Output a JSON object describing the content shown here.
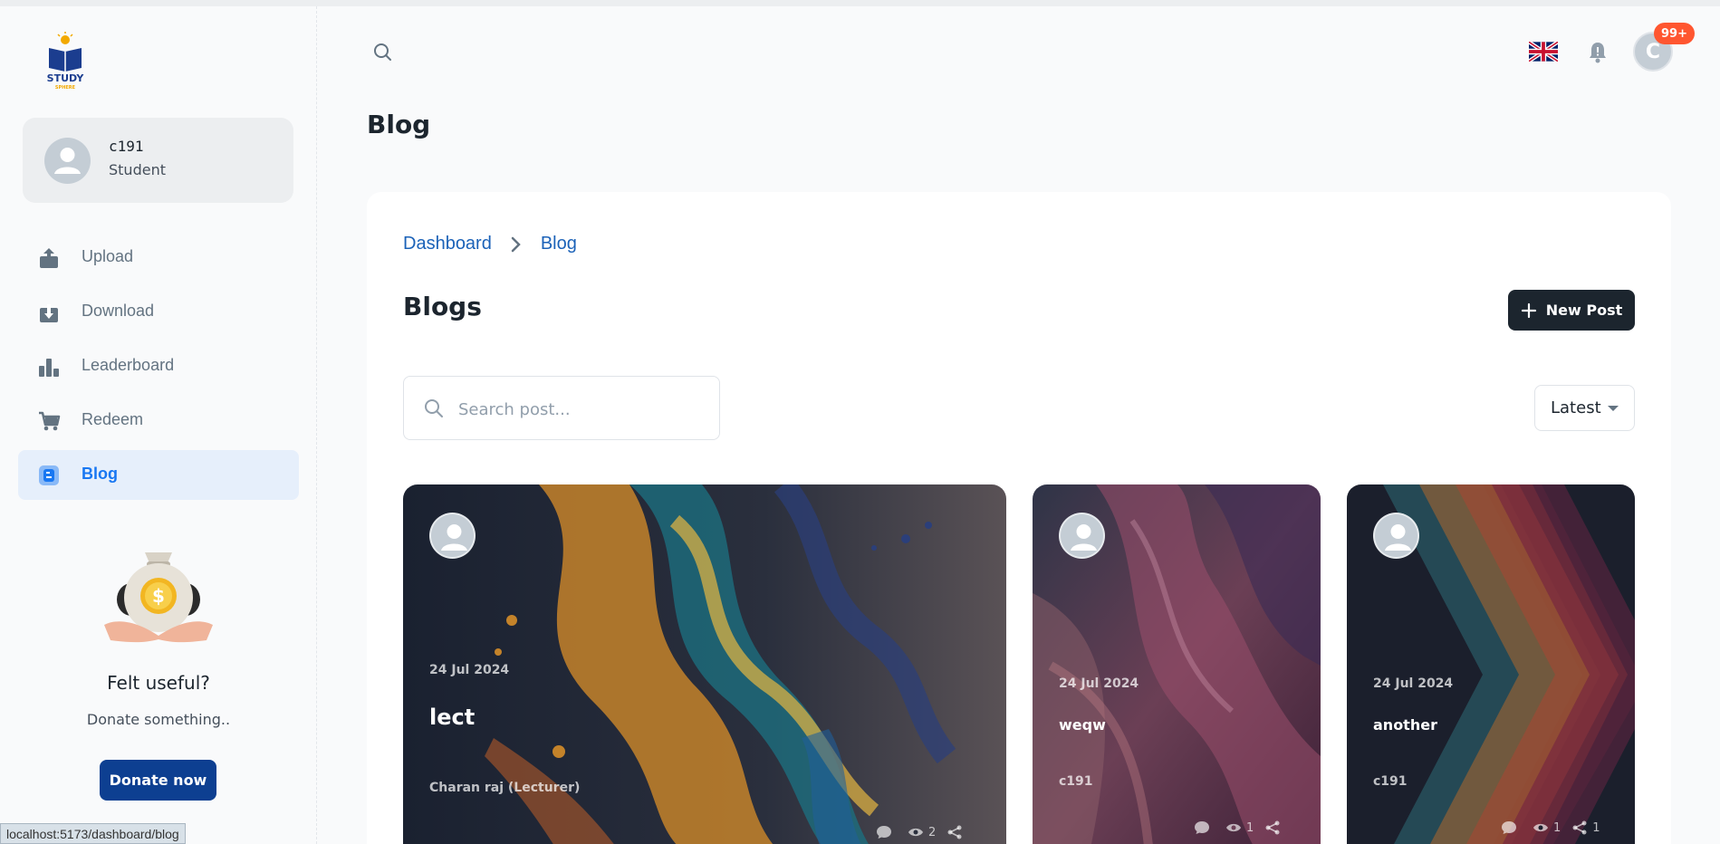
{
  "sidebar": {
    "logo_alt": "STUDY SPHERE",
    "user": {
      "name": "c191",
      "role": "Student"
    },
    "items": [
      {
        "label": "Upload",
        "icon": "upload-icon"
      },
      {
        "label": "Download",
        "icon": "download-icon"
      },
      {
        "label": "Leaderboard",
        "icon": "leaderboard-icon"
      },
      {
        "label": "Redeem",
        "icon": "cart-icon"
      },
      {
        "label": "Blog",
        "icon": "blog-icon",
        "active": true
      }
    ],
    "donate": {
      "title": "Felt useful?",
      "subtitle": "Donate something..",
      "button": "Donate now"
    }
  },
  "header": {
    "notifications_badge": "99+",
    "avatar_letter": "C",
    "page_title": "Blog"
  },
  "main": {
    "breadcrumb": [
      "Dashboard",
      "Blog"
    ],
    "heading": "Blogs",
    "new_post_label": "New Post",
    "search_placeholder": "Search post...",
    "sort_value": "Latest",
    "posts": [
      {
        "date": "24 Jul 2024",
        "title": "lect",
        "author": "Charan raj (Lecturer)",
        "comments": "",
        "views": "2",
        "shares": ""
      },
      {
        "date": "24 Jul 2024",
        "title": "weqw",
        "author": "c191",
        "comments": "",
        "views": "1",
        "shares": ""
      },
      {
        "date": "24 Jul 2024",
        "title": "another",
        "author": "c191",
        "comments": "",
        "views": "1",
        "shares": "1"
      }
    ]
  },
  "status_bar": {
    "url": "localhost:5173/dashboard/blog"
  },
  "colors": {
    "accent": "#1877f2",
    "primary_dark": "#1c252e",
    "donate": "#0d3f91",
    "badge": "#ff5630"
  }
}
